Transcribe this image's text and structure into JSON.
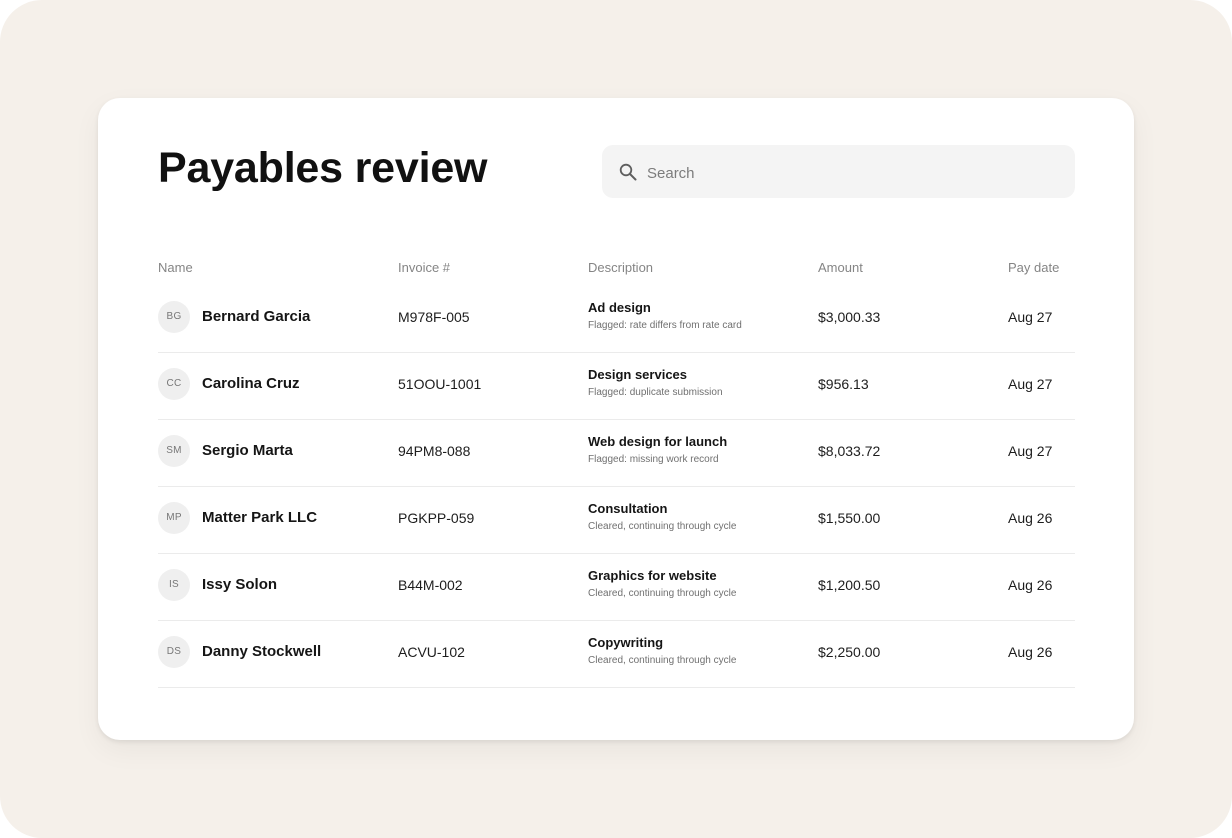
{
  "page": {
    "title": "Payables review"
  },
  "search": {
    "placeholder": "Search"
  },
  "table": {
    "columns": {
      "name": "Name",
      "invoice": "Invoice #",
      "description": "Description",
      "amount": "Amount",
      "pay_date": "Pay date"
    },
    "rows": [
      {
        "initials": "BG",
        "name": "Bernard Garcia",
        "invoice": "M978F-005",
        "description": "Ad design",
        "note": "Flagged: rate differs from rate card",
        "amount": "$3,000.33",
        "pay_date": "Aug 27"
      },
      {
        "initials": "CC",
        "name": "Carolina Cruz",
        "invoice": "51OOU-1001",
        "description": "Design services",
        "note": "Flagged: duplicate submission",
        "amount": "$956.13",
        "pay_date": "Aug 27"
      },
      {
        "initials": "SM",
        "name": "Sergio Marta",
        "invoice": "94PM8-088",
        "description": "Web design for launch",
        "note": "Flagged: missing work record",
        "amount": "$8,033.72",
        "pay_date": "Aug 27"
      },
      {
        "initials": "MP",
        "name": "Matter Park LLC",
        "invoice": "PGKPP-059",
        "description": "Consultation",
        "note": "Cleared, continuing through cycle",
        "amount": "$1,550.00",
        "pay_date": "Aug 26"
      },
      {
        "initials": "IS",
        "name": "Issy Solon",
        "invoice": "B44M-002",
        "description": "Graphics for website",
        "note": "Cleared, continuing through cycle",
        "amount": "$1,200.50",
        "pay_date": "Aug 26"
      },
      {
        "initials": "DS",
        "name": "Danny Stockwell",
        "invoice": "ACVU-102",
        "description": "Copywriting",
        "note": "Cleared, continuing through cycle",
        "amount": "$2,250.00",
        "pay_date": "Aug 26"
      }
    ]
  },
  "colors": {
    "background": "#f5f0ea",
    "card": "#ffffff",
    "search_field": "#f4f4f4",
    "avatar": "#efefef",
    "divider": "#ebebeb"
  },
  "icons": {
    "search": "search-icon"
  }
}
